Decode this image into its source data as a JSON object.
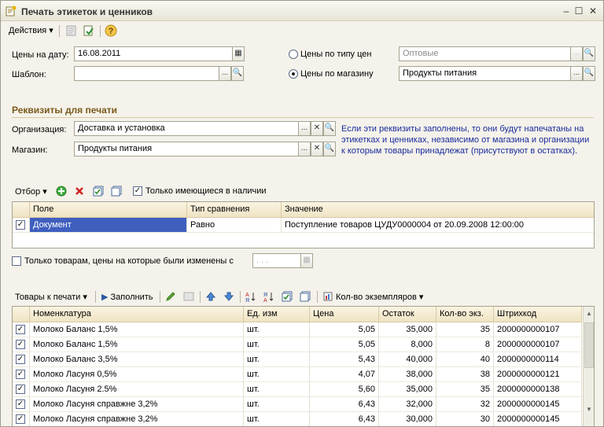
{
  "window": {
    "title": "Печать этикеток и ценников",
    "min_icon": "minimize-icon",
    "max_icon": "maximize-icon",
    "close_icon": "close-icon"
  },
  "toolbar": {
    "actions_label": "Действия",
    "help_symbol": "?"
  },
  "form": {
    "date_label": "Цены на дату:",
    "date_value": "16.08.2011",
    "template_label": "Шаблон:",
    "template_value": "",
    "price_type_label": "Цены по типу цен",
    "price_type_value": "Оптовые",
    "store_prices_label": "Цены по магазину",
    "store_prices_value": "Продукты питания",
    "price_mode": "store"
  },
  "requisites": {
    "title": "Реквизиты для печати",
    "org_label": "Организация:",
    "org_value": "Доставка и установка",
    "store_label": "Магазин:",
    "store_value": "Продукты питания",
    "info_line1": "Если эти реквизиты заполнены, то они будут напечатаны на",
    "info_line2": "этикетках и ценниках, независимо от магазина и организации",
    "info_line3": "к которым товары принадлежат (присутствуют в остатках)."
  },
  "filter": {
    "label": "Отбор",
    "only_in_stock_label": "Только имеющиеся в наличии",
    "only_in_stock": true,
    "columns": [
      "Поле",
      "Тип сравнения",
      "Значение"
    ],
    "rows": [
      {
        "checked": true,
        "field": "Документ",
        "compare": "Равно",
        "value": "Поступление товаров ЦУДУ0000004 от 20.09.2008 12:00:00"
      }
    ]
  },
  "changed_filter": {
    "label": "Только товарам, цены на которые были изменены с",
    "checked": false,
    "date_placeholder": ". . ."
  },
  "goods": {
    "menu_label": "Товары к печати",
    "fill_label": "Заполнить",
    "copies_label": "Кол-во экземпляров",
    "columns": [
      "Номенклатура",
      "Ед. изм",
      "Цена",
      "Остаток",
      "Кол-во экз.",
      "Штрихкод"
    ],
    "rows": [
      {
        "checked": true,
        "name": "Молоко Баланс 1,5%",
        "unit": "шт.",
        "price": "5,05",
        "stock": "35,000",
        "qty": "35",
        "barcode": "2000000000107"
      },
      {
        "checked": true,
        "name": "Молоко Баланс 1,5%",
        "unit": "шт.",
        "price": "5,05",
        "stock": "8,000",
        "qty": "8",
        "barcode": "2000000000107"
      },
      {
        "checked": true,
        "name": "Молоко Баланс 3,5%",
        "unit": "шт.",
        "price": "5,43",
        "stock": "40,000",
        "qty": "40",
        "barcode": "2000000000114"
      },
      {
        "checked": true,
        "name": "Молоко Ласуня 0,5%",
        "unit": "шт.",
        "price": "4,07",
        "stock": "38,000",
        "qty": "38",
        "barcode": "2000000000121"
      },
      {
        "checked": true,
        "name": "Молоко Ласуня 2.5%",
        "unit": "шт.",
        "price": "5,60",
        "stock": "35,000",
        "qty": "35",
        "barcode": "2000000000138"
      },
      {
        "checked": true,
        "name": "Молоко Ласуня справжне 3,2%",
        "unit": "шт.",
        "price": "6,43",
        "stock": "32,000",
        "qty": "32",
        "barcode": "2000000000145"
      },
      {
        "checked": true,
        "name": "Молоко Ласуня справжне 3,2%",
        "unit": "шт.",
        "price": "6,43",
        "stock": "30,000",
        "qty": "30",
        "barcode": "2000000000145"
      }
    ]
  },
  "colors": {
    "selection": "#3f5fbf",
    "section": "#7a5a1b",
    "info": "#1a2b9c"
  }
}
